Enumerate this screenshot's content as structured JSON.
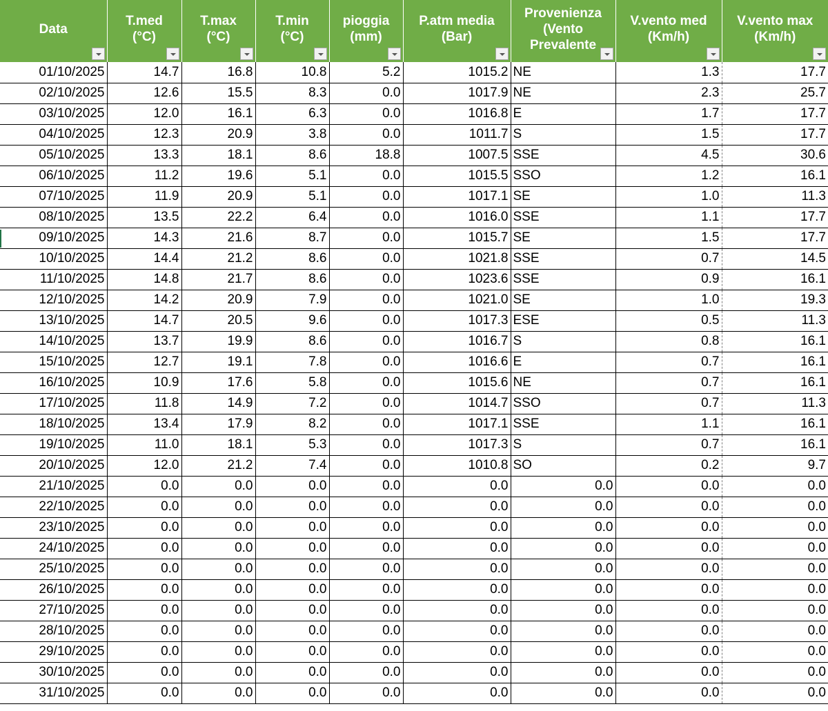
{
  "sheet": {
    "headers": [
      "Data",
      "T.med\n(°C)",
      "T.max\n(°C)",
      "T.min\n(°C)",
      "pioggia\n(mm)",
      "P.atm media\n(Bar)",
      "Provenienza\n(Vento\nPrevalente",
      "V.vento med\n(Km/h)",
      "V.vento max\n(Km/h)"
    ],
    "rows": [
      [
        "01/10/2025",
        "14.7",
        "16.8",
        "10.8",
        "5.2",
        "1015.2",
        "NE",
        "1.3",
        "17.7"
      ],
      [
        "02/10/2025",
        "12.6",
        "15.5",
        "8.3",
        "0.0",
        "1017.9",
        "NE",
        "2.3",
        "25.7"
      ],
      [
        "03/10/2025",
        "12.0",
        "16.1",
        "6.3",
        "0.0",
        "1016.8",
        "E",
        "1.7",
        "17.7"
      ],
      [
        "04/10/2025",
        "12.3",
        "20.9",
        "3.8",
        "0.0",
        "1011.7",
        "S",
        "1.5",
        "17.7"
      ],
      [
        "05/10/2025",
        "13.3",
        "18.1",
        "8.6",
        "18.8",
        "1007.5",
        "SSE",
        "4.5",
        "30.6"
      ],
      [
        "06/10/2025",
        "11.2",
        "19.6",
        "5.1",
        "0.0",
        "1015.5",
        "SSO",
        "1.2",
        "16.1"
      ],
      [
        "07/10/2025",
        "11.9",
        "20.9",
        "5.1",
        "0.0",
        "1017.1",
        "SE",
        "1.0",
        "11.3"
      ],
      [
        "08/10/2025",
        "13.5",
        "22.2",
        "6.4",
        "0.0",
        "1016.0",
        "SSE",
        "1.1",
        "17.7"
      ],
      [
        "09/10/2025",
        "14.3",
        "21.6",
        "8.7",
        "0.0",
        "1015.7",
        "SE",
        "1.5",
        "17.7"
      ],
      [
        "10/10/2025",
        "14.4",
        "21.2",
        "8.6",
        "0.0",
        "1021.8",
        "SSE",
        "0.7",
        "14.5"
      ],
      [
        "11/10/2025",
        "14.8",
        "21.7",
        "8.6",
        "0.0",
        "1023.6",
        "SSE",
        "0.9",
        "16.1"
      ],
      [
        "12/10/2025",
        "14.2",
        "20.9",
        "7.9",
        "0.0",
        "1021.0",
        "SE",
        "1.0",
        "19.3"
      ],
      [
        "13/10/2025",
        "14.7",
        "20.5",
        "9.6",
        "0.0",
        "1017.3",
        "ESE",
        "0.5",
        "11.3"
      ],
      [
        "14/10/2025",
        "13.7",
        "19.9",
        "8.6",
        "0.0",
        "1016.7",
        "S",
        "0.8",
        "16.1"
      ],
      [
        "15/10/2025",
        "12.7",
        "19.1",
        "7.8",
        "0.0",
        "1016.6",
        "E",
        "0.7",
        "16.1"
      ],
      [
        "16/10/2025",
        "10.9",
        "17.6",
        "5.8",
        "0.0",
        "1015.6",
        "NE",
        "0.7",
        "16.1"
      ],
      [
        "17/10/2025",
        "11.8",
        "14.9",
        "7.2",
        "0.0",
        "1014.7",
        "SSO",
        "0.7",
        "11.3"
      ],
      [
        "18/10/2025",
        "13.4",
        "17.9",
        "8.2",
        "0.0",
        "1017.1",
        "SSE",
        "1.1",
        "16.1"
      ],
      [
        "19/10/2025",
        "11.0",
        "18.1",
        "5.3",
        "0.0",
        "1017.3",
        "S",
        "0.7",
        "16.1"
      ],
      [
        "20/10/2025",
        "12.0",
        "21.2",
        "7.4",
        "0.0",
        "1010.8",
        "SO",
        "0.2",
        "9.7"
      ],
      [
        "21/10/2025",
        "0.0",
        "0.0",
        "0.0",
        "0.0",
        "0.0",
        "0.0",
        "0.0",
        "0.0"
      ],
      [
        "22/10/2025",
        "0.0",
        "0.0",
        "0.0",
        "0.0",
        "0.0",
        "0.0",
        "0.0",
        "0.0"
      ],
      [
        "23/10/2025",
        "0.0",
        "0.0",
        "0.0",
        "0.0",
        "0.0",
        "0.0",
        "0.0",
        "0.0"
      ],
      [
        "24/10/2025",
        "0.0",
        "0.0",
        "0.0",
        "0.0",
        "0.0",
        "0.0",
        "0.0",
        "0.0"
      ],
      [
        "25/10/2025",
        "0.0",
        "0.0",
        "0.0",
        "0.0",
        "0.0",
        "0.0",
        "0.0",
        "0.0"
      ],
      [
        "26/10/2025",
        "0.0",
        "0.0",
        "0.0",
        "0.0",
        "0.0",
        "0.0",
        "0.0",
        "0.0"
      ],
      [
        "27/10/2025",
        "0.0",
        "0.0",
        "0.0",
        "0.0",
        "0.0",
        "0.0",
        "0.0",
        "0.0"
      ],
      [
        "28/10/2025",
        "0.0",
        "0.0",
        "0.0",
        "0.0",
        "0.0",
        "0.0",
        "0.0",
        "0.0"
      ],
      [
        "29/10/2025",
        "0.0",
        "0.0",
        "0.0",
        "0.0",
        "0.0",
        "0.0",
        "0.0",
        "0.0"
      ],
      [
        "30/10/2025",
        "0.0",
        "0.0",
        "0.0",
        "0.0",
        "0.0",
        "0.0",
        "0.0",
        "0.0"
      ],
      [
        "31/10/2025",
        "0.0",
        "0.0",
        "0.0",
        "0.0",
        "0.0",
        "0.0",
        "0.0",
        "0.0"
      ]
    ]
  },
  "colors": {
    "header_background": "#70ad47",
    "header_text": "#ffffff",
    "grid_lines": "#000000",
    "selection_marker": "#217346"
  },
  "icons": {
    "filter_dropdown": "filter-dropdown-icon"
  }
}
